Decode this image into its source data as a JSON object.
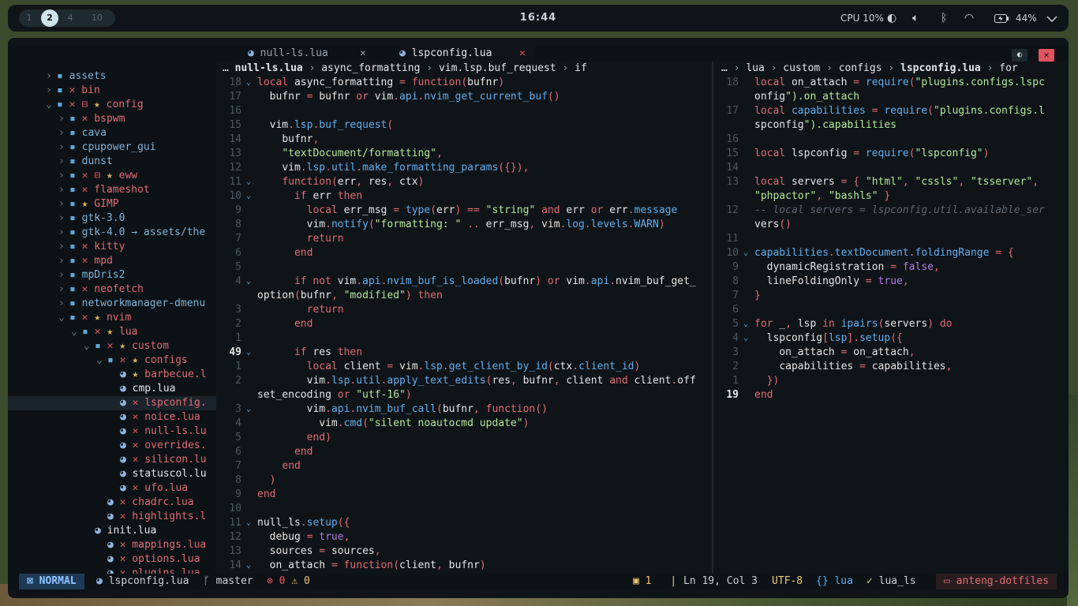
{
  "topbar": {
    "workspaces": [
      "1",
      "2",
      "4",
      "10"
    ],
    "clock": "16:44",
    "cpu": "CPU 10%",
    "battery": "44%"
  },
  "tabs": [
    {
      "name": "null-ls.lua",
      "close": "✕"
    },
    {
      "name": "lspconfig.lua",
      "close": "✕"
    }
  ],
  "tree": [
    {
      "d": 0,
      "a": "›",
      "i": "▸",
      "n": "assets",
      "c": "d"
    },
    {
      "d": 0,
      "a": "›",
      "i": "▸",
      "n": "✕ bin",
      "c": "m"
    },
    {
      "d": 0,
      "a": "⌄",
      "i": "▸",
      "n": "✕ ⊟ ★ config",
      "c": "m"
    },
    {
      "d": 1,
      "a": "›",
      "i": "▸",
      "n": "✕ bspwm",
      "c": "m"
    },
    {
      "d": 1,
      "a": "›",
      "i": "▸",
      "n": "cava",
      "c": "d"
    },
    {
      "d": 1,
      "a": "›",
      "i": "▸",
      "n": "cpupower_gui",
      "c": "d"
    },
    {
      "d": 1,
      "a": "›",
      "i": "▸",
      "n": "dunst",
      "c": "d"
    },
    {
      "d": 1,
      "a": "›",
      "i": "▸",
      "n": "✕ ⊟ ★ eww",
      "c": "m"
    },
    {
      "d": 1,
      "a": "›",
      "i": "▸",
      "n": "✕ flameshot",
      "c": "m"
    },
    {
      "d": 1,
      "a": "›",
      "i": "▸",
      "n": "★ GIMP",
      "c": "m"
    },
    {
      "d": 1,
      "a": "›",
      "i": "▸",
      "n": "gtk-3.0",
      "c": "d"
    },
    {
      "d": 1,
      "a": "›",
      "i": "▸",
      "n": "gtk-4.0 → assets/the",
      "c": "d"
    },
    {
      "d": 1,
      "a": "›",
      "i": "▸",
      "n": "✕ kitty",
      "c": "m"
    },
    {
      "d": 1,
      "a": "›",
      "i": "▸",
      "n": "✕ mpd",
      "c": "m"
    },
    {
      "d": 1,
      "a": "›",
      "i": "▸",
      "n": "mpDris2",
      "c": "d"
    },
    {
      "d": 1,
      "a": "›",
      "i": "▸",
      "n": "✕ neofetch",
      "c": "m"
    },
    {
      "d": 1,
      "a": "›",
      "i": "▸",
      "n": "networkmanager-dmenu",
      "c": "d"
    },
    {
      "d": 1,
      "a": "⌄",
      "i": "▸",
      "n": "✕ ★ nvim",
      "c": "m"
    },
    {
      "d": 2,
      "a": "⌄",
      "i": "▸",
      "n": "✕ ★ lua",
      "c": "m"
    },
    {
      "d": 3,
      "a": "⌄",
      "i": "▸",
      "n": "✕ ★ custom",
      "c": "m"
    },
    {
      "d": 4,
      "a": "⌄",
      "i": "▸",
      "n": "✕ ★ configs",
      "c": "m"
    },
    {
      "d": 5,
      "a": "",
      "i": "●",
      "n": "★ barbecue.l",
      "c": "m"
    },
    {
      "d": 5,
      "a": "",
      "i": "●",
      "n": "cmp.lua",
      "c": "f"
    },
    {
      "d": 5,
      "a": "",
      "i": "●",
      "n": "✕ lspconfig.",
      "c": "m",
      "sel": true
    },
    {
      "d": 5,
      "a": "",
      "i": "●",
      "n": "✕ noice.lua",
      "c": "m"
    },
    {
      "d": 5,
      "a": "",
      "i": "●",
      "n": "✕ null-ls.lu",
      "c": "m"
    },
    {
      "d": 5,
      "a": "",
      "i": "●",
      "n": "✕ overrides.",
      "c": "m"
    },
    {
      "d": 5,
      "a": "",
      "i": "●",
      "n": "✕ silicon.lu",
      "c": "m"
    },
    {
      "d": 5,
      "a": "",
      "i": "●",
      "n": "statuscol.lu",
      "c": "f"
    },
    {
      "d": 5,
      "a": "",
      "i": "●",
      "n": "✕ ufo.lua",
      "c": "m"
    },
    {
      "d": 4,
      "a": "",
      "i": "●",
      "n": "✕ chadrc.lua",
      "c": "m"
    },
    {
      "d": 4,
      "a": "",
      "i": "●",
      "n": "✕ highlights.l",
      "c": "m"
    },
    {
      "d": 3,
      "a": "",
      "i": "●",
      "n": "init.lua",
      "c": "f"
    },
    {
      "d": 4,
      "a": "",
      "i": "●",
      "n": "✕ mappings.lua",
      "c": "m"
    },
    {
      "d": 4,
      "a": "",
      "i": "●",
      "n": "✕ options.lua",
      "c": "m"
    },
    {
      "d": 4,
      "a": "",
      "i": "●",
      "n": "✕ plugins.lua",
      "c": "m"
    }
  ],
  "crumb_left": [
    "…",
    "null-ls.lua",
    "›",
    "async_formatting",
    "›",
    "vim.lsp.buf_request",
    "›",
    "if"
  ],
  "crumb_right": [
    "…",
    "›",
    "lua",
    "›",
    "custom",
    "›",
    "configs",
    "›",
    "lspconfig.lua",
    "›",
    "for"
  ],
  "left_lines": [
    {
      "n": "18",
      "fold": true,
      "t": "local async_formatting = function(bufnr)"
    },
    {
      "n": "17",
      "t": "  bufnr = bufnr or vim.api.nvim_get_current_buf()"
    },
    {
      "n": "16",
      "t": ""
    },
    {
      "n": "15",
      "t": "  vim.lsp.buf_request("
    },
    {
      "n": "14",
      "t": "    bufnr,"
    },
    {
      "n": "13",
      "t": "    \"textDocument/formatting\","
    },
    {
      "n": "12",
      "t": "    vim.lsp.util.make_formatting_params({}),"
    },
    {
      "n": "11",
      "fold": true,
      "t": "    function(err, res, ctx)"
    },
    {
      "n": "10",
      "fold": true,
      "t": "      if err then"
    },
    {
      "n": "9",
      "t": "        local err_msg = type(err) == \"string\" and err or err.message"
    },
    {
      "n": "8",
      "t": "        vim.notify(\"formatting: \" .. err_msg, vim.log.levels.WARN)"
    },
    {
      "n": "7",
      "t": "        return"
    },
    {
      "n": "6",
      "t": "      end"
    },
    {
      "n": "5",
      "t": ""
    },
    {
      "n": "4",
      "fold": true,
      "t": "      if not vim.api.nvim_buf_is_loaded(bufnr) or vim.api.nvim_buf_get_"
    },
    {
      "n": "",
      "t": "option(bufnr, \"modified\") then"
    },
    {
      "n": "3",
      "t": "        return"
    },
    {
      "n": "2",
      "t": "      end"
    },
    {
      "n": "1",
      "t": ""
    },
    {
      "n": "49",
      "cur": true,
      "fold": true,
      "t": "      if res then"
    },
    {
      "n": "1",
      "t": "        local client = vim.lsp.get_client_by_id(ctx.client_id)"
    },
    {
      "n": "2",
      "t": "        vim.lsp.util.apply_text_edits(res, bufnr, client and client.off"
    },
    {
      "n": "",
      "t": "set_encoding or \"utf-16\")"
    },
    {
      "n": "3",
      "fold": true,
      "t": "        vim.api.nvim_buf_call(bufnr, function()"
    },
    {
      "n": "4",
      "t": "          vim.cmd(\"silent noautocmd update\")"
    },
    {
      "n": "5",
      "t": "        end)"
    },
    {
      "n": "6",
      "t": "      end"
    },
    {
      "n": "7",
      "t": "    end"
    },
    {
      "n": "8",
      "t": "  )"
    },
    {
      "n": "9",
      "t": "end"
    },
    {
      "n": "10",
      "t": ""
    },
    {
      "n": "11",
      "fold": true,
      "t": "null_ls.setup({"
    },
    {
      "n": "12",
      "t": "  debug = true,"
    },
    {
      "n": "13",
      "t": "  sources = sources,"
    },
    {
      "n": "14",
      "fold": true,
      "t": "  on_attach = function(client, bufnr)"
    }
  ],
  "right_lines": [
    {
      "n": "18",
      "t": "local on_attach = require(\"plugins.configs.lspc"
    },
    {
      "n": "",
      "t": "onfig\").on_attach"
    },
    {
      "n": "17",
      "t": "local capabilities = require(\"plugins.configs.l"
    },
    {
      "n": "",
      "t": "spconfig\").capabilities"
    },
    {
      "n": "16",
      "t": ""
    },
    {
      "n": "15",
      "t": "local lspconfig = require(\"lspconfig\")"
    },
    {
      "n": "14",
      "t": ""
    },
    {
      "n": "13",
      "t": "local servers = { \"html\", \"cssls\", \"tsserver\","
    },
    {
      "n": "",
      "t": "\"phpactor\", \"bashls\" }"
    },
    {
      "n": "12",
      "t": "-- local servers = lspconfig.util.available_ser"
    },
    {
      "n": "",
      "t": "vers()"
    },
    {
      "n": "11",
      "t": ""
    },
    {
      "n": "10",
      "fold": true,
      "t": "capabilities.textDocument.foldingRange = {"
    },
    {
      "n": "9",
      "t": "  dynamicRegistration = false,"
    },
    {
      "n": "8",
      "t": "  lineFoldingOnly = true,"
    },
    {
      "n": "7",
      "t": "}"
    },
    {
      "n": "6",
      "t": ""
    },
    {
      "n": "5",
      "fold": true,
      "t": "for _, lsp in ipairs(servers) do"
    },
    {
      "n": "4",
      "fold": true,
      "t": "  lspconfig[lsp].setup({"
    },
    {
      "n": "3",
      "t": "    on_attach = on_attach,"
    },
    {
      "n": "2",
      "t": "    capabilities = capabilities,"
    },
    {
      "n": "1",
      "t": "  })"
    },
    {
      "n": "19",
      "cur": true,
      "t": "end"
    }
  ],
  "status": {
    "mode": "NORMAL",
    "file": "lspconfig.lua",
    "branch": "master",
    "errors": "0",
    "warnings": "0",
    "sel": "1",
    "pos": "Ln 19, Col 3",
    "enc": "UTF-8",
    "ft": "lua",
    "lsp": "lua_ls",
    "project": "anteng-dotfiles"
  },
  "colors": {
    "accent": "#5fa7d8",
    "keyword": "#e06c75",
    "string": "#b5e89b",
    "func": "#61afef"
  }
}
